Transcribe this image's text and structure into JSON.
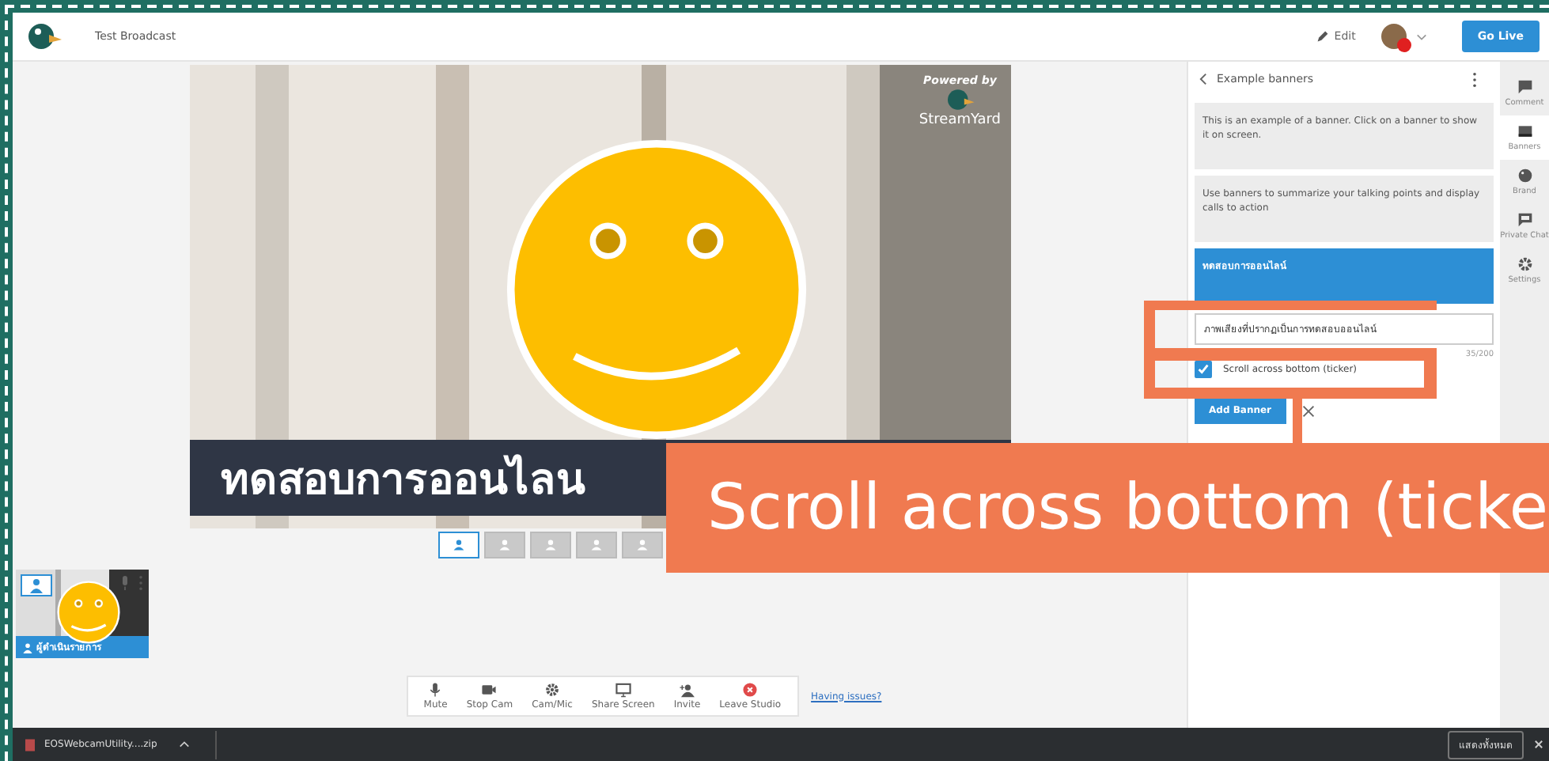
{
  "header": {
    "title": "Test Broadcast",
    "edit": "Edit",
    "go_live": "Go Live"
  },
  "stage": {
    "banner_text": "ทดสอบการออนไลน",
    "powered_by": "Powered by",
    "brand": "StreamYard"
  },
  "layouts": [
    {
      "selected": true
    },
    {
      "selected": false
    },
    {
      "selected": false
    },
    {
      "selected": false
    },
    {
      "selected": false
    }
  ],
  "guest": {
    "name": "ผู้ดำเนินรายการ"
  },
  "controls": [
    {
      "kind": "mic",
      "label": "Mute"
    },
    {
      "kind": "cam",
      "label": "Stop Cam"
    },
    {
      "kind": "gear",
      "label": "Cam/Mic"
    },
    {
      "kind": "screen",
      "label": "Share Screen"
    },
    {
      "kind": "invite",
      "label": "Invite"
    },
    {
      "kind": "leave",
      "label": "Leave Studio"
    }
  ],
  "help_link": "Having issues?",
  "panel": {
    "title": "Example banners",
    "banners": [
      {
        "text": "This is an example of a banner. Click on a banner to show it on screen.",
        "selected": false
      },
      {
        "text": "Use banners to summarize your talking points and display calls to action",
        "selected": false
      },
      {
        "text": "ทดสอบการออนไลน์",
        "selected": true
      }
    ],
    "input_value": "ภาพเสียงที่ปรากฏเป็นการทดสอบออนไลน์",
    "counter": "35/200",
    "ticker_label": "Scroll across bottom (ticker)",
    "ticker_checked": true,
    "add_button": "Add Banner"
  },
  "sidebar": [
    {
      "kind": "comment",
      "label": "Comment",
      "selected": false
    },
    {
      "kind": "banner",
      "label": "Banners",
      "selected": true
    },
    {
      "kind": "brand",
      "label": "Brand",
      "selected": false
    },
    {
      "kind": "chat",
      "label": "Private Chat",
      "selected": false
    },
    {
      "kind": "settings",
      "label": "Settings",
      "selected": false
    }
  ],
  "downloads": {
    "file": "EOSWebcamUtility....zip",
    "show_all": "แสดงทั้งหมด"
  },
  "annotation": {
    "text": "Scroll across bottom (ticke"
  }
}
